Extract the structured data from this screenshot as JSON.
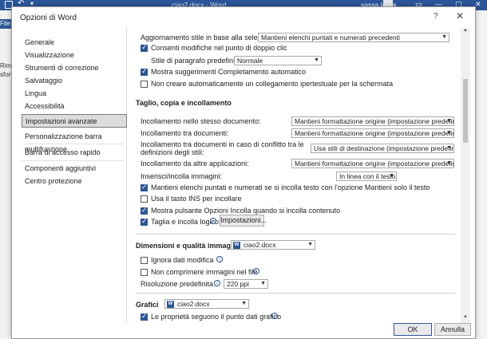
{
  "word": {
    "doc_title": "ciao2.docx - Word",
    "user": "sassa lassa",
    "file_tab": "File",
    "left_text_1": "Rimu",
    "left_text_2": "sfon"
  },
  "dialog": {
    "title": "Opzioni di Word",
    "help": "?",
    "close": "✕",
    "ok_label": "OK",
    "cancel_label": "Annulla"
  },
  "nav": {
    "items": [
      "Generale",
      "Visualizzazione",
      "Strumenti di correzione",
      "Salvataggio",
      "Lingua",
      "Accessibilità",
      "Impostazioni avanzate",
      "Personalizzazione barra multifunzione",
      "Barra di accesso rapido",
      "Componenti aggiuntivi",
      "Centro protezione"
    ],
    "active_index": 6
  },
  "edit": {
    "style_update_label": "Aggiornamento stile in base alla selezione:",
    "style_update_value": "Mantieni elenchi puntati e numerati precedenti",
    "dblclick_label": "Consenti modifiche nel punto di doppio clic",
    "dblclick_checked": true,
    "para_style_label": "Stile di paragrafo predefinito:",
    "para_style_value": "Normale",
    "autocomplete_label": "Mostra suggerimenti Completamento automatico",
    "autocomplete_checked": true,
    "hyperlink_label": "Non creare automaticamente un collegamento ipertestuale per la schermata",
    "hyperlink_checked": false
  },
  "paste": {
    "header": "Taglio, copia e incollamento",
    "same_doc_label": "Incollamento nello stesso documento:",
    "same_doc_value": "Mantieni formattazione origine (impostazione predefinita)",
    "between_docs_label": "Incollamento tra documenti:",
    "between_docs_value": "Mantieni formattazione origine (impostazione predefinita)",
    "conflict_label_1": "Incollamento tra documenti in caso di conflitto tra le",
    "conflict_label_2": "definizioni degli stili:",
    "conflict_value": "Usa stili di destinazione (impostazione predefinita)",
    "other_apps_label": "Incollamento da altre applicazioni:",
    "other_apps_value": "Mantieni formattazione origine (impostazione predefinita)",
    "images_label": "Inserisci/incolla immagini:",
    "images_value": "In linea con il testo",
    "keep_bullets_label": "Mantieni elenchi puntati e numerati se si incolla testo con l'opzione Mantieni solo il testo",
    "keep_bullets_checked": true,
    "ins_key_label": "Usa il tasto INS per incollare",
    "ins_key_checked": false,
    "paste_options_label": "Mostra pulsante Opzioni Incolla quando si incolla contenuto",
    "paste_options_checked": true,
    "smart_cut_label": "Taglia e incolla logico",
    "smart_cut_checked": true,
    "settings_button": "Impostazioni..."
  },
  "image": {
    "header": "Dimensioni e qualità immagine",
    "doc_value": "ciao2.docx",
    "ignore_edit_label": "Ignora dati modifica",
    "ignore_edit_checked": false,
    "no_compress_label": "Non comprimere immagini nel file",
    "no_compress_checked": false,
    "resolution_label": "Risoluzione predefinita:",
    "resolution_value": "220 ppi"
  },
  "charts": {
    "header": "Grafici",
    "doc_value": "ciao2.docx",
    "follow_point_label": "Le proprietà seguono il punto dati grafico",
    "follow_point_checked": true
  }
}
